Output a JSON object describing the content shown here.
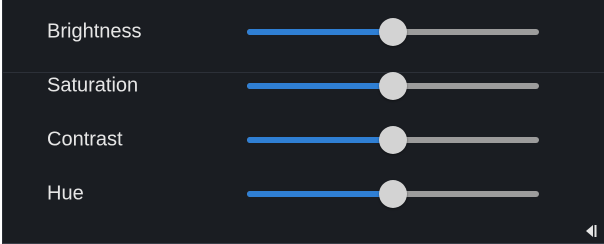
{
  "colors": {
    "background": "#1a1d22",
    "label": "#e6e6e6",
    "fill": "#2f7fd4",
    "track": "#9c9c9c",
    "thumb": "#d3d3d3"
  },
  "sliders": [
    {
      "label": "Brightness",
      "value": 0.5
    },
    {
      "label": "Saturation",
      "value": 0.5
    },
    {
      "label": "Contrast",
      "value": 0.5
    },
    {
      "label": "Hue",
      "value": 0.5
    }
  ],
  "collapse_icon": "collapse-panel-icon"
}
